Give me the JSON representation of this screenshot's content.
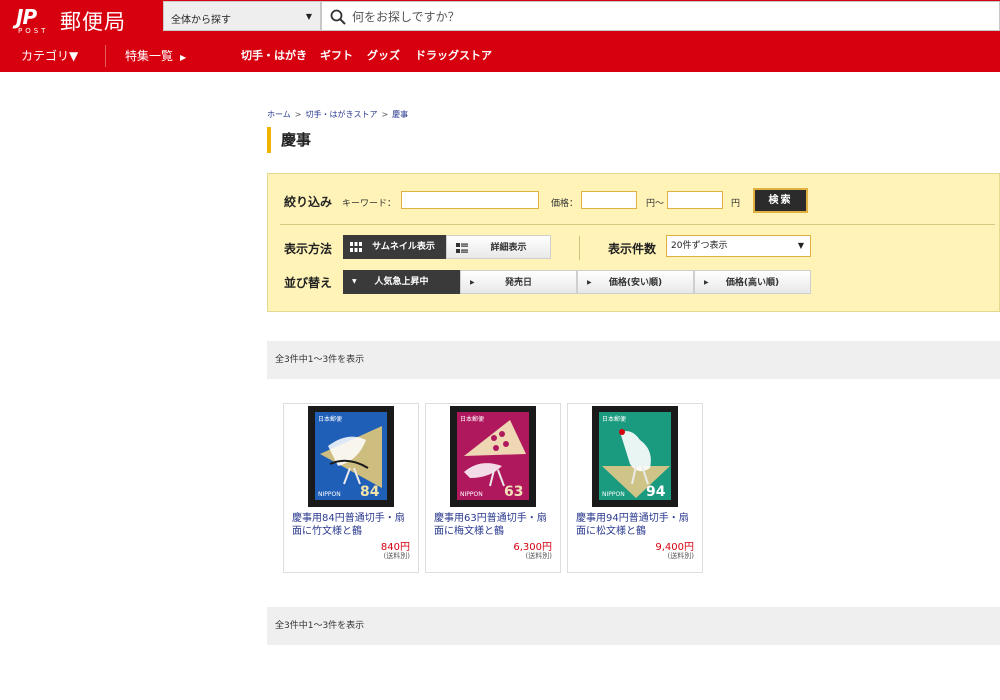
{
  "header": {
    "logo_mark": "JP",
    "logo_sub": "POST",
    "logo_text": "郵便局",
    "search_scope": "全体から探す",
    "search_placeholder": "何をお探しですか？",
    "brand_color": "#d7000f"
  },
  "nav": {
    "category": "カテゴリ▼",
    "special": "特集一覧",
    "links": [
      "切手・はがき",
      "ギフト",
      "グッズ",
      "ドラッグストア"
    ]
  },
  "breadcrumb": [
    "ホーム",
    "切手・はがきストア",
    "慶事"
  ],
  "page_title": "慶事",
  "filter": {
    "narrow_label": "絞り込み",
    "keyword_label": "キーワード：",
    "price_label": "価格：",
    "price_from_unit": "円〜",
    "price_to_unit": "円",
    "search_button": "検索",
    "display_label": "表示方法",
    "display_options": [
      "サムネイル表示",
      "詳細表示"
    ],
    "count_label": "表示件数",
    "count_value": "20件ずつ表示",
    "sort_label": "並び替え",
    "sort_options": [
      "人気急上昇中",
      "発売日",
      "価格(安い順)",
      "価格(高い順)"
    ]
  },
  "result_count_text": "全3件中1～3件を表示",
  "products": [
    {
      "name": "慶事用84円普通切手・扇面に竹文様と鶴",
      "price": "840円",
      "note": "(送料別)",
      "stamp": {
        "country": "日本郵便",
        "nippon": "NIPPON",
        "value": "84",
        "bg": "#1f5fb8",
        "fan": "#d7c27a"
      }
    },
    {
      "name": "慶事用63円普通切手・扇面に梅文様と鶴",
      "price": "6,300円",
      "note": "(送料別)",
      "stamp": {
        "country": "日本郵便",
        "nippon": "NIPPON",
        "value": "63",
        "bg": "#b0185e",
        "fan": "#f3e2b8"
      }
    },
    {
      "name": "慶事用94円普通切手・扇面に松文様と鶴",
      "price": "9,400円",
      "note": "(送料別)",
      "stamp": {
        "country": "日本郵便",
        "nippon": "NIPPON",
        "value": "94",
        "bg": "#1a9a7e",
        "fan": "#d9c688"
      }
    }
  ]
}
